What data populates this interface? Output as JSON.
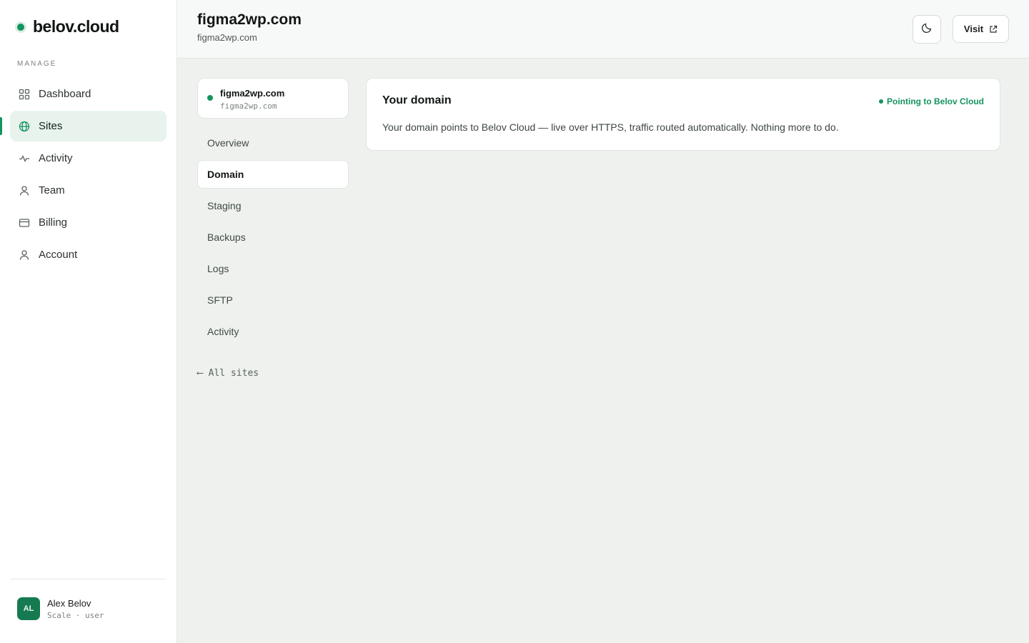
{
  "brand": {
    "name": "belov.cloud",
    "accent": "#14935f"
  },
  "sidebar": {
    "section_label": "MANAGE",
    "items": [
      {
        "label": "Dashboard",
        "icon": "grid-icon"
      },
      {
        "label": "Sites",
        "icon": "globe-icon",
        "active": true
      },
      {
        "label": "Activity",
        "icon": "pulse-icon"
      },
      {
        "label": "Team",
        "icon": "person-icon"
      },
      {
        "label": "Billing",
        "icon": "card-icon"
      },
      {
        "label": "Account",
        "icon": "person-icon"
      }
    ],
    "user": {
      "initials": "AL",
      "name": "Alex Belov",
      "plan": "Scale · user"
    }
  },
  "header": {
    "title": "figma2wp.com",
    "subtitle": "figma2wp.com",
    "theme_icon": "moon-icon",
    "visit_label": "Visit"
  },
  "site": {
    "name": "figma2wp.com",
    "host": "figma2wp.com",
    "tabs": [
      "Overview",
      "Domain",
      "Staging",
      "Backups",
      "Logs",
      "SFTP",
      "Activity"
    ],
    "active_tab": "Domain",
    "back_label": "⟵ All sites"
  },
  "domain": {
    "title": "Your domain",
    "status": "Pointing to Belov Cloud",
    "description": "Your domain points to Belov Cloud — live over HTTPS, traffic routed automatically. Nothing more to do."
  }
}
